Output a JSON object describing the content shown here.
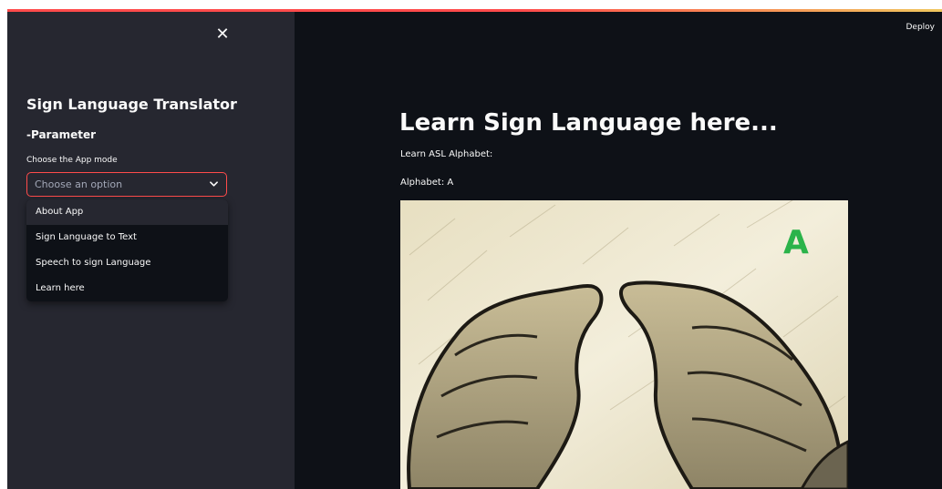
{
  "sidebar": {
    "close_icon": "close-icon",
    "title": "Sign Language Translator",
    "subtitle": "-Parameter",
    "select_label": "Choose the App mode",
    "select_placeholder": "Choose an option",
    "options": [
      {
        "label": "About App",
        "highlighted": true
      },
      {
        "label": "Sign Language to Text",
        "highlighted": false
      },
      {
        "label": "Speech to sign Language",
        "highlighted": false
      },
      {
        "label": "Learn here",
        "highlighted": false
      }
    ]
  },
  "header": {
    "deploy_label": "Deploy"
  },
  "main": {
    "title": "Learn Sign Language here...",
    "learn_label": "Learn ASL Alphabet:",
    "alphabet_label": "Alphabet: A",
    "image_letter": "A"
  },
  "colors": {
    "accent": "#ff4b4b",
    "sidebar_bg": "#262730",
    "main_bg": "#0e1117",
    "letter_green": "#2bb34a"
  }
}
